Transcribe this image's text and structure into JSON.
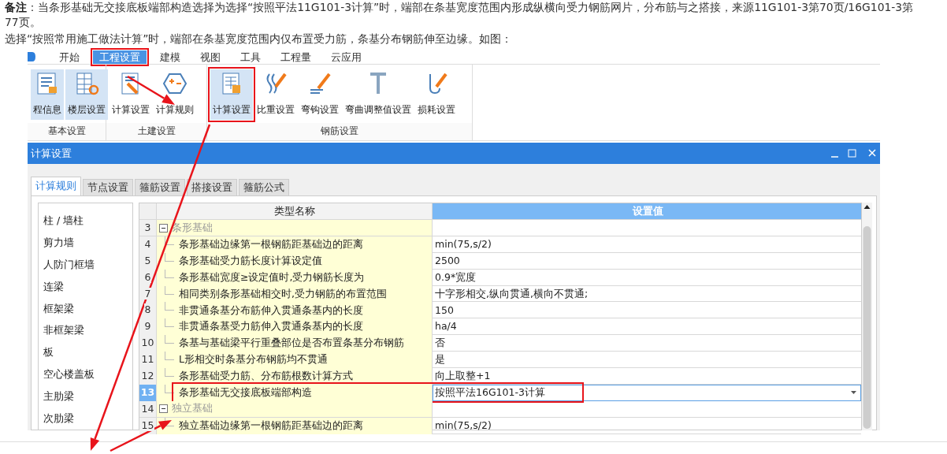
{
  "note": [
    "**备注**：当条形基础无交接底板端部构造选择为选择“按照平法11G101-3计算”时，端部在条基宽度范围内形成纵横向受力钢筋网片，分布筋与之搭接，来源11G101-3第70页/16G101-3第77页。",
    "选择“按照常用施工做法计算”时，端部在条基宽度范围内仅布置受力筋，条基分布钢筋伸至边缘。如图："
  ],
  "ribbon_tabs": [
    {
      "label": "开始",
      "selected": false,
      "highlighted": false
    },
    {
      "label": "工程设置",
      "selected": true,
      "highlighted": true
    },
    {
      "label": "建模",
      "selected": false,
      "highlighted": false
    },
    {
      "label": "视图",
      "selected": false,
      "highlighted": false
    },
    {
      "label": "工具",
      "selected": false,
      "highlighted": false
    },
    {
      "label": "工程量",
      "selected": false,
      "highlighted": false
    },
    {
      "label": "云应用",
      "selected": false,
      "highlighted": false
    }
  ],
  "ribbon_groups": [
    {
      "label": "基本设置",
      "buttons": [
        {
          "label": "程信息",
          "kind": "info",
          "selected": true,
          "highlighted": false
        },
        {
          "label": "楼层设置",
          "kind": "floor",
          "selected": true,
          "highlighted": false
        }
      ]
    },
    {
      "label": "土建设置",
      "buttons": [
        {
          "label": "计算设置",
          "kind": "calc",
          "selected": false,
          "highlighted": false
        },
        {
          "label": "计算规则",
          "kind": "rules",
          "selected": false,
          "highlighted": false
        }
      ]
    },
    {
      "label": "钢筋设置",
      "buttons": [
        {
          "label": "计算设置",
          "kind": "table",
          "selected": true,
          "highlighted": true
        },
        {
          "label": "比重设置",
          "kind": "density",
          "selected": false,
          "highlighted": false
        },
        {
          "label": "弯钩设置",
          "kind": "hook",
          "selected": false,
          "highlighted": false
        },
        {
          "label": "弯曲调整值设置",
          "kind": "bend",
          "selected": false,
          "highlighted": false
        },
        {
          "label": "损耗设置",
          "kind": "loss",
          "selected": false,
          "highlighted": false
        }
      ]
    }
  ],
  "dialog": {
    "title": "计算设置",
    "tabs": [
      {
        "label": "计算规则",
        "selected": true
      },
      {
        "label": "节点设置",
        "selected": false
      },
      {
        "label": "箍筋设置",
        "selected": false
      },
      {
        "label": "搭接设置",
        "selected": false
      },
      {
        "label": "箍筋公式",
        "selected": false
      }
    ],
    "categories": [
      {
        "label": "柱 / 墙柱",
        "selected": false
      },
      {
        "label": "剪力墙",
        "selected": false
      },
      {
        "label": "人防门框墙",
        "selected": false
      },
      {
        "label": "连梁",
        "selected": false
      },
      {
        "label": "框架梁",
        "selected": false
      },
      {
        "label": "非框架梁",
        "selected": false
      },
      {
        "label": "板",
        "selected": false
      },
      {
        "label": "空心楼盖板",
        "selected": false
      },
      {
        "label": "主肋梁",
        "selected": false
      },
      {
        "label": "次肋梁",
        "selected": false
      }
    ],
    "table": {
      "columns": [
        "类型名称",
        "设置值"
      ],
      "rows": [
        {
          "num": "3",
          "kind": "group",
          "name": "条形基础",
          "expanded": true,
          "value": "",
          "selected": false,
          "highlighted": false
        },
        {
          "num": "4",
          "kind": "item",
          "name": "条形基础边缘第一根钢筋距基础边的距离",
          "value": "min(75,s/2)",
          "selected": false,
          "highlighted": false
        },
        {
          "num": "5",
          "kind": "item",
          "name": "条形基础受力筋长度计算设定值",
          "value": "2500",
          "selected": false,
          "highlighted": false
        },
        {
          "num": "6",
          "kind": "item",
          "name": "条形基础宽度≥设定值时,受力钢筋长度为",
          "value": "0.9*宽度",
          "selected": false,
          "highlighted": false
        },
        {
          "num": "7",
          "kind": "item",
          "name": "相同类别条形基础相交时,受力钢筋的布置范围",
          "value": "十字形相交,纵向贯通,横向不贯通;",
          "selected": false,
          "highlighted": false
        },
        {
          "num": "8",
          "kind": "item",
          "name": "非贯通条基分布筋伸入贯通条基内的长度",
          "value": "150",
          "selected": false,
          "highlighted": false
        },
        {
          "num": "9",
          "kind": "item",
          "name": "非贯通条基受力筋伸入贯通条基内的长度",
          "value": "ha/4",
          "selected": false,
          "highlighted": false
        },
        {
          "num": "10",
          "kind": "item",
          "name": "条基与基础梁平行重叠部位是否布置条基分布钢筋",
          "value": "否",
          "selected": false,
          "highlighted": false
        },
        {
          "num": "11",
          "kind": "item",
          "name": "L形相交时条基分布钢筋均不贯通",
          "value": "是",
          "selected": false,
          "highlighted": false
        },
        {
          "num": "12",
          "kind": "item",
          "name": "条形基础受力筋、分布筋根数计算方式",
          "value": "向上取整+1",
          "selected": false,
          "highlighted": false
        },
        {
          "num": "13",
          "kind": "item",
          "name": "条形基础无交接底板端部构造",
          "value": "按照平法16G101-3计算",
          "selected": true,
          "highlighted": true
        },
        {
          "num": "14",
          "kind": "group",
          "name": "独立基础",
          "expanded": true,
          "value": "",
          "selected": false,
          "highlighted": false
        },
        {
          "num": "15",
          "kind": "item",
          "name": "独立基础边缘第一根钢筋距基础边的距离",
          "value": "min(75,s/2)",
          "selected": false,
          "highlighted": false
        }
      ]
    }
  }
}
